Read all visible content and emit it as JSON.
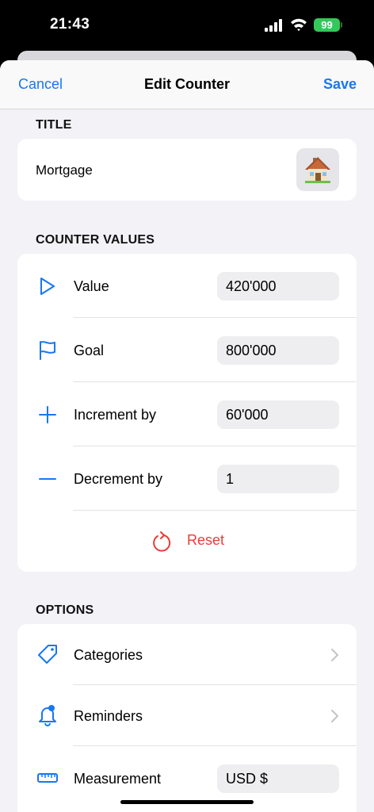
{
  "status": {
    "time": "21:43",
    "battery": "99"
  },
  "nav": {
    "cancel": "Cancel",
    "title": "Edit Counter",
    "save": "Save"
  },
  "title_section": {
    "header": "TITLE",
    "value": "Mortgage",
    "emoji": "🏠"
  },
  "values_section": {
    "header": "COUNTER VALUES",
    "rows": [
      {
        "icon": "play-icon",
        "label": "Value",
        "value": "420'000"
      },
      {
        "icon": "flag-icon",
        "label": "Goal",
        "value": "800'000"
      },
      {
        "icon": "plus-icon",
        "label": "Increment by",
        "value": "60'000"
      },
      {
        "icon": "minus-icon",
        "label": "Decrement by",
        "value": "1"
      }
    ],
    "reset": "Reset"
  },
  "options_section": {
    "header": "OPTIONS",
    "rows": [
      {
        "icon": "tag-icon",
        "label": "Categories"
      },
      {
        "icon": "bell-icon",
        "label": "Reminders"
      },
      {
        "icon": "ruler-icon",
        "label": "Measurement",
        "value": "USD $"
      }
    ]
  },
  "colors": {
    "accent": "#1877f2",
    "destructive": "#ea3c35",
    "background": "#f2f2f7"
  }
}
